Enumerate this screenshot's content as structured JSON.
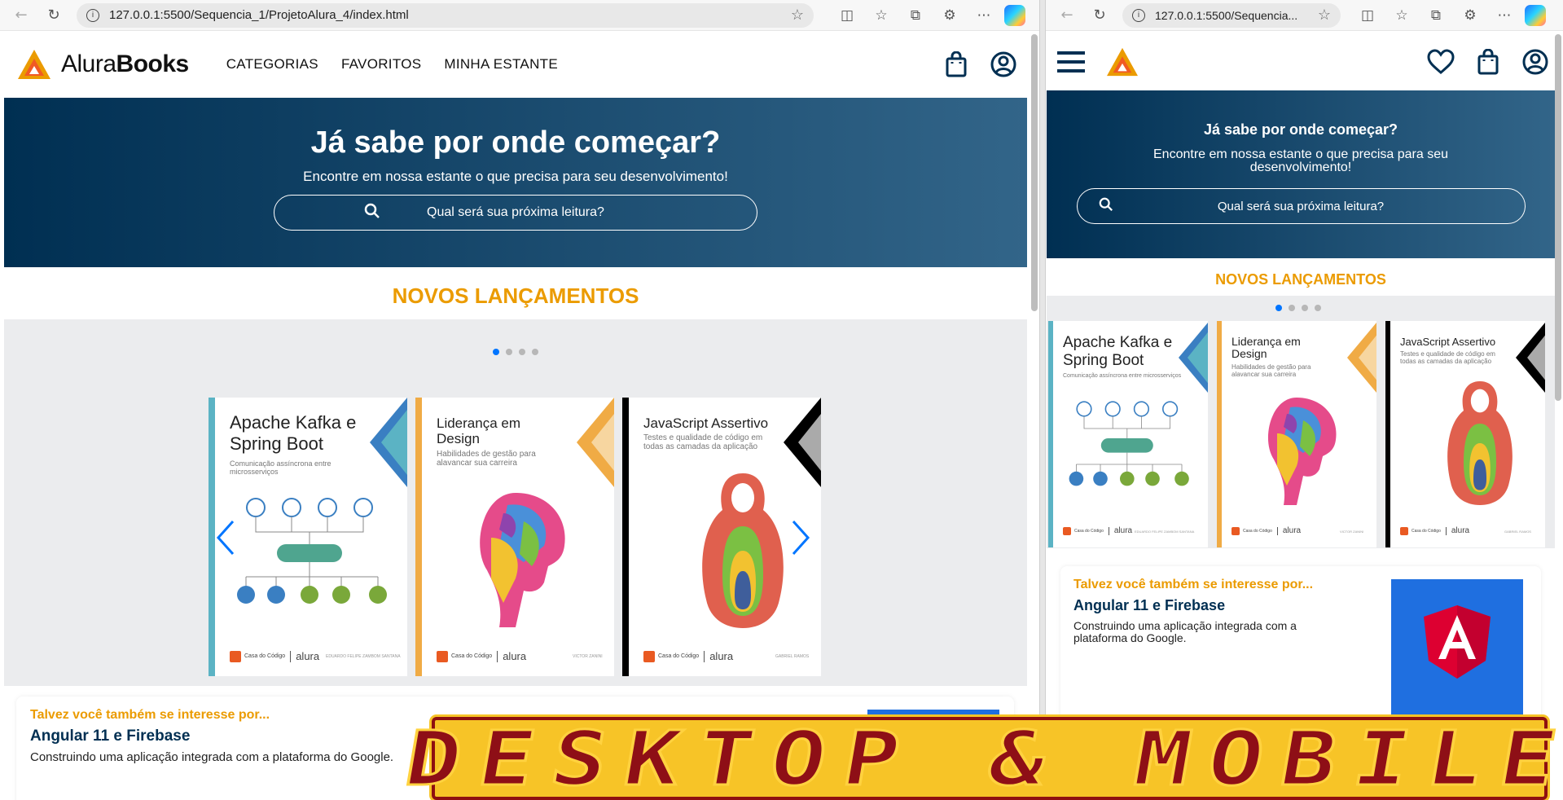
{
  "desktop": {
    "url": "127.0.0.1:5500/Sequencia_1/ProjetoAlura_4/index.html",
    "brand": {
      "part1": "Alura",
      "part2": "Books"
    },
    "nav": [
      "CATEGORIAS",
      "FAVORITOS",
      "MINHA ESTANTE"
    ],
    "hero": {
      "title": "Já sabe por onde começar?",
      "subtitle": "Encontre em nossa estante o que precisa para seu desenvolvimento!",
      "search_placeholder": "Qual será sua próxima leitura?"
    },
    "section_title": "NOVOS LANÇAMENTOS",
    "recommend": {
      "kicker": "Talvez você também se interesse por...",
      "title": "Angular 11 e Firebase",
      "description": "Construindo uma aplicação integrada com a plataforma do Google."
    }
  },
  "mobile": {
    "url": "127.0.0.1:5500/Sequencia...",
    "hero": {
      "title": "Já sabe por onde começar?",
      "subtitle": "Encontre em nossa estante o que precisa para seu desenvolvimento!",
      "search_placeholder": "Qual será sua próxima leitura?"
    },
    "section_title": "NOVOS LANÇAMENTOS",
    "recommend": {
      "kicker": "Talvez você também se interesse por...",
      "title": "Angular 11 e Firebase",
      "description": "Construindo uma aplicação integrada com a plataforma do Google."
    }
  },
  "books": [
    {
      "title": "Apache Kafka e Spring Boot",
      "subtitle": "Comunicação assíncrona entre microsserviços",
      "author": "EDUARDO FELIPE ZAMBOM SANTANA",
      "accent": "#5bb3c4",
      "publisher": "Casa do Código",
      "partner": "alura"
    },
    {
      "title": "Liderança em Design",
      "subtitle": "Habilidades de gestão para alavancar sua carreira",
      "author": "VICTOR ZANINI",
      "accent": "#f0ab45",
      "publisher": "Casa do Código",
      "partner": "alura"
    },
    {
      "title": "JavaScript Assertivo",
      "subtitle": "Testes e qualidade de código em todas as camadas da aplicação",
      "author": "GABRIEL RAMOS",
      "accent": "#000000",
      "publisher": "Casa do Código",
      "partner": "alura"
    }
  ],
  "banner": "DESKTOP & MOBILE",
  "colors": {
    "hero_start": "#002f52",
    "hero_end": "#326589",
    "accent": "#eb9b00",
    "banner_bg": "#f7c427",
    "banner_text": "#8e0f16",
    "dot_active": "#0075ff"
  }
}
